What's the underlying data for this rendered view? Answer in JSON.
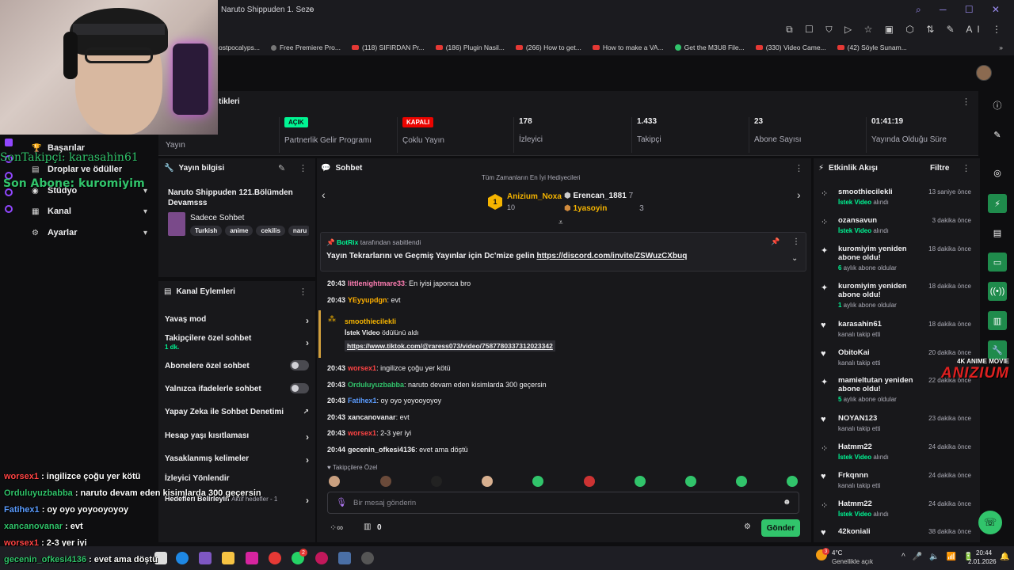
{
  "browser": {
    "tab_title": "Naruto Shippuden 1. Sezo",
    "new_tab": "+",
    "bookmarks": [
      "ostpocalyps...",
      "Free Premiere Pro...",
      "(118) SIFIRDAN Pr...",
      "(186) Plugin Nasil...",
      "(266) How to get...",
      "How to make a VA...",
      "Get the M3U8 File...",
      "(330) Video Came...",
      "(42) Söyle Sunam..."
    ],
    "bookmarks_more": "»",
    "ai_label": "AI"
  },
  "overlay": {
    "last_follower": "SonTakipçi: karasahin61",
    "last_sub": "Son Abone: kuromiyim"
  },
  "stats": {
    "title": "tikleri",
    "items": [
      {
        "value": "",
        "label": "Yayın"
      },
      {
        "badge": "AÇIK",
        "label": "Partnerlik Gelir Programı"
      },
      {
        "badge": "KAPALI",
        "label": "Çoklu Yayın"
      },
      {
        "value": "178",
        "label": "İzleyici"
      },
      {
        "value": "1.433",
        "label": "Takipçi"
      },
      {
        "value": "23",
        "label": "Abone Sayısı"
      },
      {
        "value": "01:41:19",
        "label": "Yayında Olduğu Süre"
      }
    ]
  },
  "leftnav": {
    "items": [
      "Başarılar",
      "Droplar ve ödüller",
      "Stüdyo",
      "Kanal",
      "Ayarlar"
    ]
  },
  "stream_info": {
    "header": "Yayın bilgisi",
    "title": "Naruto Shippuden 121.Bölümden Devamsss",
    "category": "Sadece Sohbet",
    "tags": [
      "Turkish",
      "anime",
      "cekilis",
      "naru"
    ]
  },
  "channel_actions": {
    "header": "Kanal Eylemleri",
    "slow_mode": "Yavaş mod",
    "followers_only": "Takipçilere özel sohbet",
    "followers_only_sub": "1 dk.",
    "subs_only": "Abonelere özel sohbet",
    "emotes_only": "Yalnızca ifadelerle sohbet",
    "ai_moderation": "Yapay Zeka ile Sohbet Denetimi",
    "age_restrict": "Hesap yaşı kısıtlaması",
    "banned_words": "Yasaklanmış kelimeler",
    "viewer_guide": "İzleyici Yönlendir",
    "goals": "Hedefleri Belirleyin",
    "goals_active": "Aktif hedefler - 1"
  },
  "chat": {
    "header": "Sohbet",
    "leaderboard_top": "Tüm Zamanların En İyi Hediyecileri",
    "leader1_rank": "1",
    "leader1_name": "Anizium_Noxa",
    "leader1_score": "10",
    "leader2_name": "Erencan_1881",
    "leader2_score": "7",
    "leader3_name": "1yasoyin",
    "leader3_score": "3",
    "pinned_by": "BotRix",
    "pinned_by_suffix": "tarafından sabitlendi",
    "pinned_text": "Yayın Tekrarlarını ve Geçmiş Yayınlar için Dc'mize gelin",
    "pinned_link": "https://discord.com/invite/ZSWuzCXbuq",
    "messages": [
      {
        "time": "20:43",
        "user": "littlenightmare33",
        "color": "#ff7eb3",
        "text": ": En iyisi japonca bro"
      },
      {
        "time": "20:43",
        "user": "YEyyupdgn",
        "color": "#ffb000",
        "text": ": evt"
      }
    ],
    "redeem_user": "smoothiecilekli",
    "redeem_reward": "İstek Video",
    "redeem_text": "ödülünü aldı",
    "redeem_link": "https://www.tiktok.com/@raress073/video/7587780337312023342",
    "messages2": [
      {
        "time": "20:43",
        "user": "worsex1",
        "color": "#ff4444",
        "text": ": ingilizce çoğu yer kötü"
      },
      {
        "time": "20:43",
        "user": "Orduluyuzbabba",
        "color": "#31c46b",
        "text": ": naruto devam eden kisimlarda 300 geçersin"
      },
      {
        "time": "20:43",
        "user": "Fatihex1",
        "color": "#5b9cff",
        "text": ": oy oyo yoyooyoyoy"
      },
      {
        "time": "20:43",
        "user": "xancanovanar",
        "color": "#efeff1",
        "text": ": evt"
      },
      {
        "time": "20:43",
        "user": "worsex1",
        "color": "#ff4444",
        "text": ": 2-3 yer iyi"
      },
      {
        "time": "20:44",
        "user": "gecenin_ofkesi4136",
        "color": "#efeff1",
        "text": ": evet ama döştü"
      }
    ],
    "followers_only_label": "Takipçilere Özel",
    "input_placeholder": "Bir mesaj gönderin",
    "points": "0",
    "send": "Gönder"
  },
  "activity": {
    "header": "Etkinlik Akışı",
    "filter": "Filtre",
    "events": [
      {
        "name": "smoothiecilekli",
        "sub": "İstek Video",
        "sub2": " alındı",
        "time": "13 saniye önce",
        "icon": "gift"
      },
      {
        "name": "ozansavun",
        "sub": "İstek Video",
        "sub2": " alındı",
        "time": "3 dakika önce",
        "icon": "gift"
      },
      {
        "name": "kuromiyim yeniden abone oldu!",
        "sub": "6",
        "sub2": " aylık abone oldular",
        "time": "18 dakika önce",
        "icon": "star"
      },
      {
        "name": "kuromiyim yeniden abone oldu!",
        "sub": "1",
        "sub2": " aylık abone oldular",
        "time": "18 dakika önce",
        "icon": "star"
      },
      {
        "name": "karasahin61",
        "sub": "",
        "sub2": "kanalı takip etti",
        "time": "18 dakika önce",
        "icon": "heart"
      },
      {
        "name": "ObitoKai",
        "sub": "",
        "sub2": "kanalı takip etti",
        "time": "20 dakika önce",
        "icon": "heart"
      },
      {
        "name": "mamieltutan yeniden abone oldu!",
        "sub": "5",
        "sub2": " aylık abone oldular",
        "time": "22 dakika önce",
        "icon": "star"
      },
      {
        "name": "NOYAN123",
        "sub": "",
        "sub2": "kanalı takip etti",
        "time": "23 dakika önce",
        "icon": "heart"
      },
      {
        "name": "Hatmm22",
        "sub": "İstek Video",
        "sub2": " alındı",
        "time": "24 dakika önce",
        "icon": "gift"
      },
      {
        "name": "Frkqnnn",
        "sub": "",
        "sub2": "kanalı takip etti",
        "time": "24 dakika önce",
        "icon": "heart"
      },
      {
        "name": "Hatmm22",
        "sub": "İstek Video",
        "sub2": " alındı",
        "time": "24 dakika önce",
        "icon": "gift"
      },
      {
        "name": "42koniali",
        "sub": "",
        "sub2": "",
        "time": "38 dakika önce",
        "icon": "heart"
      }
    ]
  },
  "logo": {
    "line1": "4K ANIME MOVIE",
    "line2": "ANIZIUM"
  },
  "overlay_chat": [
    {
      "user": "worsex1",
      "color": "#ff4444",
      "text": " : ingilizce çoğu yer kötü"
    },
    {
      "user": "Orduluyuzbabba",
      "color": "#31c46b",
      "text": " : naruto devam eden kisimlarda 300 geçersin"
    },
    {
      "user": "Fatihex1",
      "color": "#5b9cff",
      "text": " : oy oyo yoyooyoyoy"
    },
    {
      "user": "xancanovanar",
      "color": "#31c46b",
      "text": " : evt"
    },
    {
      "user": "worsex1",
      "color": "#ff4444",
      "text": " : 2-3 yer iyi"
    },
    {
      "user": "gecenin_ofkesi4136",
      "color": "#31c46b",
      "text": " : evet ama döştü"
    }
  ],
  "taskbar": {
    "temp": "4°C",
    "weather": "Genellikle açık",
    "time": "20:44",
    "date": "2.01.2026",
    "badge1": "2",
    "badge2": "3"
  },
  "colors": {
    "accent": "#31c46b",
    "twitch_purple": "#9147ff",
    "panel": "#18181b",
    "bg": "#0e0e10"
  }
}
